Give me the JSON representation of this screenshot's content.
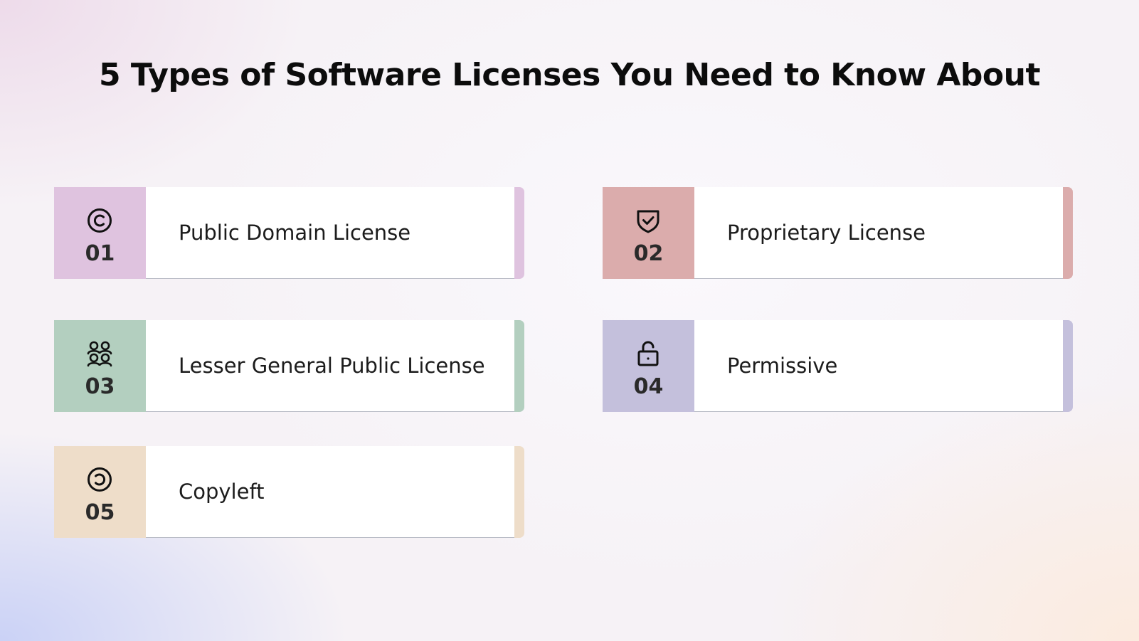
{
  "title": "5 Types of Software Licenses You Need to Know About",
  "cards": [
    {
      "number": "01",
      "label": "Public Domain License",
      "icon": "copyright-icon",
      "color": "#dfc3df"
    },
    {
      "number": "02",
      "label": "Proprietary License",
      "icon": "shield-check-icon",
      "color": "#dbacac"
    },
    {
      "number": "03",
      "label": "Lesser General Public License",
      "icon": "users-group-icon",
      "color": "#b3cfbf"
    },
    {
      "number": "04",
      "label": "Permissive",
      "icon": "unlocked-padlock-icon",
      "color": "#c4c0dc"
    },
    {
      "number": "05",
      "label": "Copyleft",
      "icon": "copyleft-icon",
      "color": "#eeddc9"
    }
  ]
}
